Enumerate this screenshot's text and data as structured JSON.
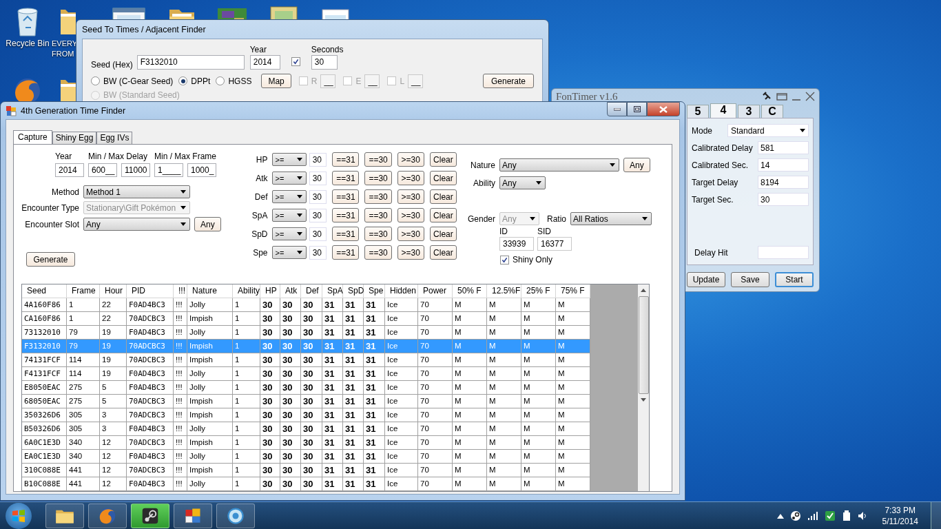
{
  "desktop": {
    "icons": [
      {
        "kind": "recycle",
        "label": [
          "Recycle Bin"
        ]
      },
      {
        "kind": "folder",
        "label": [
          "EVERY",
          "FROM"
        ]
      },
      {
        "kind": "screenshot"
      },
      {
        "kind": "folder"
      },
      {
        "kind": "game"
      },
      {
        "kind": "map"
      },
      {
        "kind": "document"
      },
      {
        "kind": "firefox"
      },
      {
        "kind": "folder"
      }
    ]
  },
  "seed_window": {
    "title": "Seed To Times / Adjacent Finder",
    "seed": {
      "label": "Seed (Hex)",
      "value": "F3132010"
    },
    "year": {
      "label": "Year",
      "value": "2014"
    },
    "seconds": {
      "label": "Seconds",
      "value": "30",
      "checked": true
    },
    "games": [
      {
        "label": "BW (C-Gear Seed)",
        "selected": false
      },
      {
        "label": "DPPt",
        "selected": true
      },
      {
        "label": "HGSS",
        "selected": false
      }
    ],
    "map_button": "Map",
    "slots": [
      {
        "label": "R",
        "value": "__",
        "checked": false
      },
      {
        "label": "E",
        "value": "__",
        "checked": false
      },
      {
        "label": "L",
        "value": "__",
        "checked": false
      }
    ],
    "generate_button": "Generate",
    "standard_seed": {
      "label": "BW (Standard Seed)",
      "selected": false
    }
  },
  "timer_window": {
    "title": "FonTimer v1.6",
    "tabs": [
      {
        "label": "5",
        "selected": false
      },
      {
        "label": "4",
        "selected": true
      },
      {
        "label": "3",
        "selected": false
      },
      {
        "label": "C",
        "selected": false
      }
    ],
    "mode": {
      "label": "Mode",
      "value": "Standard"
    },
    "fields": [
      {
        "label": "Calibrated Delay",
        "value": "581"
      },
      {
        "label": "Calibrated Sec.",
        "value": "14"
      },
      {
        "label": "Target Delay",
        "value": "8194"
      },
      {
        "label": "Target Sec.",
        "value": "30"
      }
    ],
    "delay_hit": {
      "label": "Delay Hit"
    },
    "buttons": [
      {
        "label": "Update",
        "focused": false
      },
      {
        "label": "Save",
        "focused": false
      },
      {
        "label": "Start",
        "focused": true
      }
    ]
  },
  "finder_window": {
    "title": "4th Generation Time Finder",
    "tabs": [
      {
        "label": "Capture",
        "selected": true
      },
      {
        "label": "Shiny Egg",
        "selected": false
      },
      {
        "label": "Egg IVs",
        "selected": false
      }
    ],
    "ranges": [
      {
        "label": "Year",
        "values": [
          "2014"
        ]
      },
      {
        "label": "Min / Max Delay",
        "values": [
          "600__",
          "11000"
        ]
      },
      {
        "label": "Min / Max Frame",
        "values": [
          "1____",
          "1000_"
        ]
      }
    ],
    "selects": [
      {
        "label": "Method",
        "value": "Method 1",
        "disabled": false
      },
      {
        "label": "Encounter Type",
        "value": "Stationary\\Gift Pokémon",
        "disabled": true
      },
      {
        "label": "Encounter Slot",
        "value": "Any",
        "disabled": false,
        "button": "Any"
      }
    ],
    "generate_button": "Generate",
    "ivs": [
      {
        "stat": "HP",
        "op": ">=",
        "value": "30",
        "buttons": [
          "==31",
          "==30",
          ">=30",
          "Clear"
        ]
      },
      {
        "stat": "Atk",
        "op": ">=",
        "value": "30",
        "buttons": [
          "==31",
          "==30",
          ">=30",
          "Clear"
        ]
      },
      {
        "stat": "Def",
        "op": ">=",
        "value": "30",
        "buttons": [
          "==31",
          "==30",
          ">=30",
          "Clear"
        ]
      },
      {
        "stat": "SpA",
        "op": ">=",
        "value": "30",
        "buttons": [
          "==31",
          "==30",
          ">=30",
          "Clear"
        ]
      },
      {
        "stat": "SpD",
        "op": ">=",
        "value": "30",
        "buttons": [
          "==31",
          "==30",
          ">=30",
          "Clear"
        ]
      },
      {
        "stat": "Spe",
        "op": ">=",
        "value": "30",
        "buttons": [
          "==31",
          "==30",
          ">=30",
          "Clear"
        ]
      }
    ],
    "nature": {
      "label": "Nature",
      "value": "Any",
      "button": "Any"
    },
    "ability": {
      "label": "Ability",
      "value": "Any"
    },
    "gender": {
      "label": "Gender",
      "value": "Any",
      "disabled": true
    },
    "ratio": {
      "label": "Ratio",
      "value": "All Ratios"
    },
    "id": {
      "label": "ID",
      "value": "33939"
    },
    "sid": {
      "label": "SID",
      "value": "16377"
    },
    "shiny_only": {
      "label": "Shiny Only",
      "checked": true
    },
    "table": {
      "columns": [
        {
          "label": "Seed",
          "kind": "mono"
        },
        {
          "label": "Frame",
          "kind": "text"
        },
        {
          "label": "Hour",
          "kind": "text"
        },
        {
          "label": "PID",
          "kind": "mono"
        },
        {
          "label": "!!!",
          "kind": "text"
        },
        {
          "label": "Nature",
          "kind": "text"
        },
        {
          "label": "Ability",
          "kind": "text"
        },
        {
          "label": "HP",
          "kind": "iv"
        },
        {
          "label": "Atk",
          "kind": "iv"
        },
        {
          "label": "Def",
          "kind": "iv"
        },
        {
          "label": "SpA",
          "kind": "iv"
        },
        {
          "label": "SpD",
          "kind": "iv"
        },
        {
          "label": "Spe",
          "kind": "iv"
        },
        {
          "label": "Hidden",
          "kind": "text"
        },
        {
          "label": "Power",
          "kind": "text"
        },
        {
          "label": "50% F",
          "kind": "text"
        },
        {
          "label": "12.5%F",
          "kind": "text"
        },
        {
          "label": "25% F",
          "kind": "text"
        },
        {
          "label": "75% F",
          "kind": "text"
        }
      ],
      "rows": [
        {
          "selected": false,
          "cells": [
            "4A160F86",
            "1",
            "22",
            "F0AD4BC3",
            "!!!",
            "Jolly",
            "1",
            "30",
            "30",
            "30",
            "31",
            "31",
            "31",
            "Ice",
            "70",
            "M",
            "M",
            "M",
            "M"
          ]
        },
        {
          "selected": false,
          "cells": [
            "CA160F86",
            "1",
            "22",
            "70ADCBC3",
            "!!!",
            "Impish",
            "1",
            "30",
            "30",
            "30",
            "31",
            "31",
            "31",
            "Ice",
            "70",
            "M",
            "M",
            "M",
            "M"
          ]
        },
        {
          "selected": false,
          "cells": [
            "73132010",
            "79",
            "19",
            "F0AD4BC3",
            "!!!",
            "Jolly",
            "1",
            "30",
            "30",
            "30",
            "31",
            "31",
            "31",
            "Ice",
            "70",
            "M",
            "M",
            "M",
            "M"
          ]
        },
        {
          "selected": true,
          "cells": [
            "F3132010",
            "79",
            "19",
            "70ADCBC3",
            "!!!",
            "Impish",
            "1",
            "30",
            "30",
            "30",
            "31",
            "31",
            "31",
            "Ice",
            "70",
            "M",
            "M",
            "M",
            "M"
          ]
        },
        {
          "selected": false,
          "cells": [
            "74131FCF",
            "114",
            "19",
            "70ADCBC3",
            "!!!",
            "Impish",
            "1",
            "30",
            "30",
            "30",
            "31",
            "31",
            "31",
            "Ice",
            "70",
            "M",
            "M",
            "M",
            "M"
          ]
        },
        {
          "selected": false,
          "cells": [
            "F4131FCF",
            "114",
            "19",
            "F0AD4BC3",
            "!!!",
            "Jolly",
            "1",
            "30",
            "30",
            "30",
            "31",
            "31",
            "31",
            "Ice",
            "70",
            "M",
            "M",
            "M",
            "M"
          ]
        },
        {
          "selected": false,
          "cells": [
            "E8050EAC",
            "275",
            "5",
            "F0AD4BC3",
            "!!!",
            "Jolly",
            "1",
            "30",
            "30",
            "30",
            "31",
            "31",
            "31",
            "Ice",
            "70",
            "M",
            "M",
            "M",
            "M"
          ]
        },
        {
          "selected": false,
          "cells": [
            "68050EAC",
            "275",
            "5",
            "70ADCBC3",
            "!!!",
            "Impish",
            "1",
            "30",
            "30",
            "30",
            "31",
            "31",
            "31",
            "Ice",
            "70",
            "M",
            "M",
            "M",
            "M"
          ]
        },
        {
          "selected": false,
          "cells": [
            "350326D6",
            "305",
            "3",
            "70ADCBC3",
            "!!!",
            "Impish",
            "1",
            "30",
            "30",
            "30",
            "31",
            "31",
            "31",
            "Ice",
            "70",
            "M",
            "M",
            "M",
            "M"
          ]
        },
        {
          "selected": false,
          "cells": [
            "B50326D6",
            "305",
            "3",
            "F0AD4BC3",
            "!!!",
            "Jolly",
            "1",
            "30",
            "30",
            "30",
            "31",
            "31",
            "31",
            "Ice",
            "70",
            "M",
            "M",
            "M",
            "M"
          ]
        },
        {
          "selected": false,
          "cells": [
            "6A0C1E3D",
            "340",
            "12",
            "70ADCBC3",
            "!!!",
            "Impish",
            "1",
            "30",
            "30",
            "30",
            "31",
            "31",
            "31",
            "Ice",
            "70",
            "M",
            "M",
            "M",
            "M"
          ]
        },
        {
          "selected": false,
          "cells": [
            "EA0C1E3D",
            "340",
            "12",
            "F0AD4BC3",
            "!!!",
            "Jolly",
            "1",
            "30",
            "30",
            "30",
            "31",
            "31",
            "31",
            "Ice",
            "70",
            "M",
            "M",
            "M",
            "M"
          ]
        },
        {
          "selected": false,
          "cells": [
            "310C088E",
            "441",
            "12",
            "70ADCBC3",
            "!!!",
            "Impish",
            "1",
            "30",
            "30",
            "30",
            "31",
            "31",
            "31",
            "Ice",
            "70",
            "M",
            "M",
            "M",
            "M"
          ]
        },
        {
          "selected": false,
          "cells": [
            "B10C088E",
            "441",
            "12",
            "F0AD4BC3",
            "!!!",
            "Jolly",
            "1",
            "30",
            "30",
            "30",
            "31",
            "31",
            "31",
            "Ice",
            "70",
            "M",
            "M",
            "M",
            "M"
          ]
        }
      ]
    }
  },
  "taskbar": {
    "apps": [
      {
        "kind": "folder",
        "active": false
      },
      {
        "kind": "firefox",
        "active": false
      },
      {
        "kind": "steam",
        "active": true
      },
      {
        "kind": "tiles",
        "active": false
      },
      {
        "kind": "globe",
        "active": false
      }
    ],
    "tray": [
      {
        "kind": "arrow"
      },
      {
        "kind": "steam"
      },
      {
        "kind": "signal"
      },
      {
        "kind": "check"
      },
      {
        "kind": "device"
      },
      {
        "kind": "speaker"
      }
    ],
    "time": "7:33 PM",
    "date": "5/11/2014"
  }
}
